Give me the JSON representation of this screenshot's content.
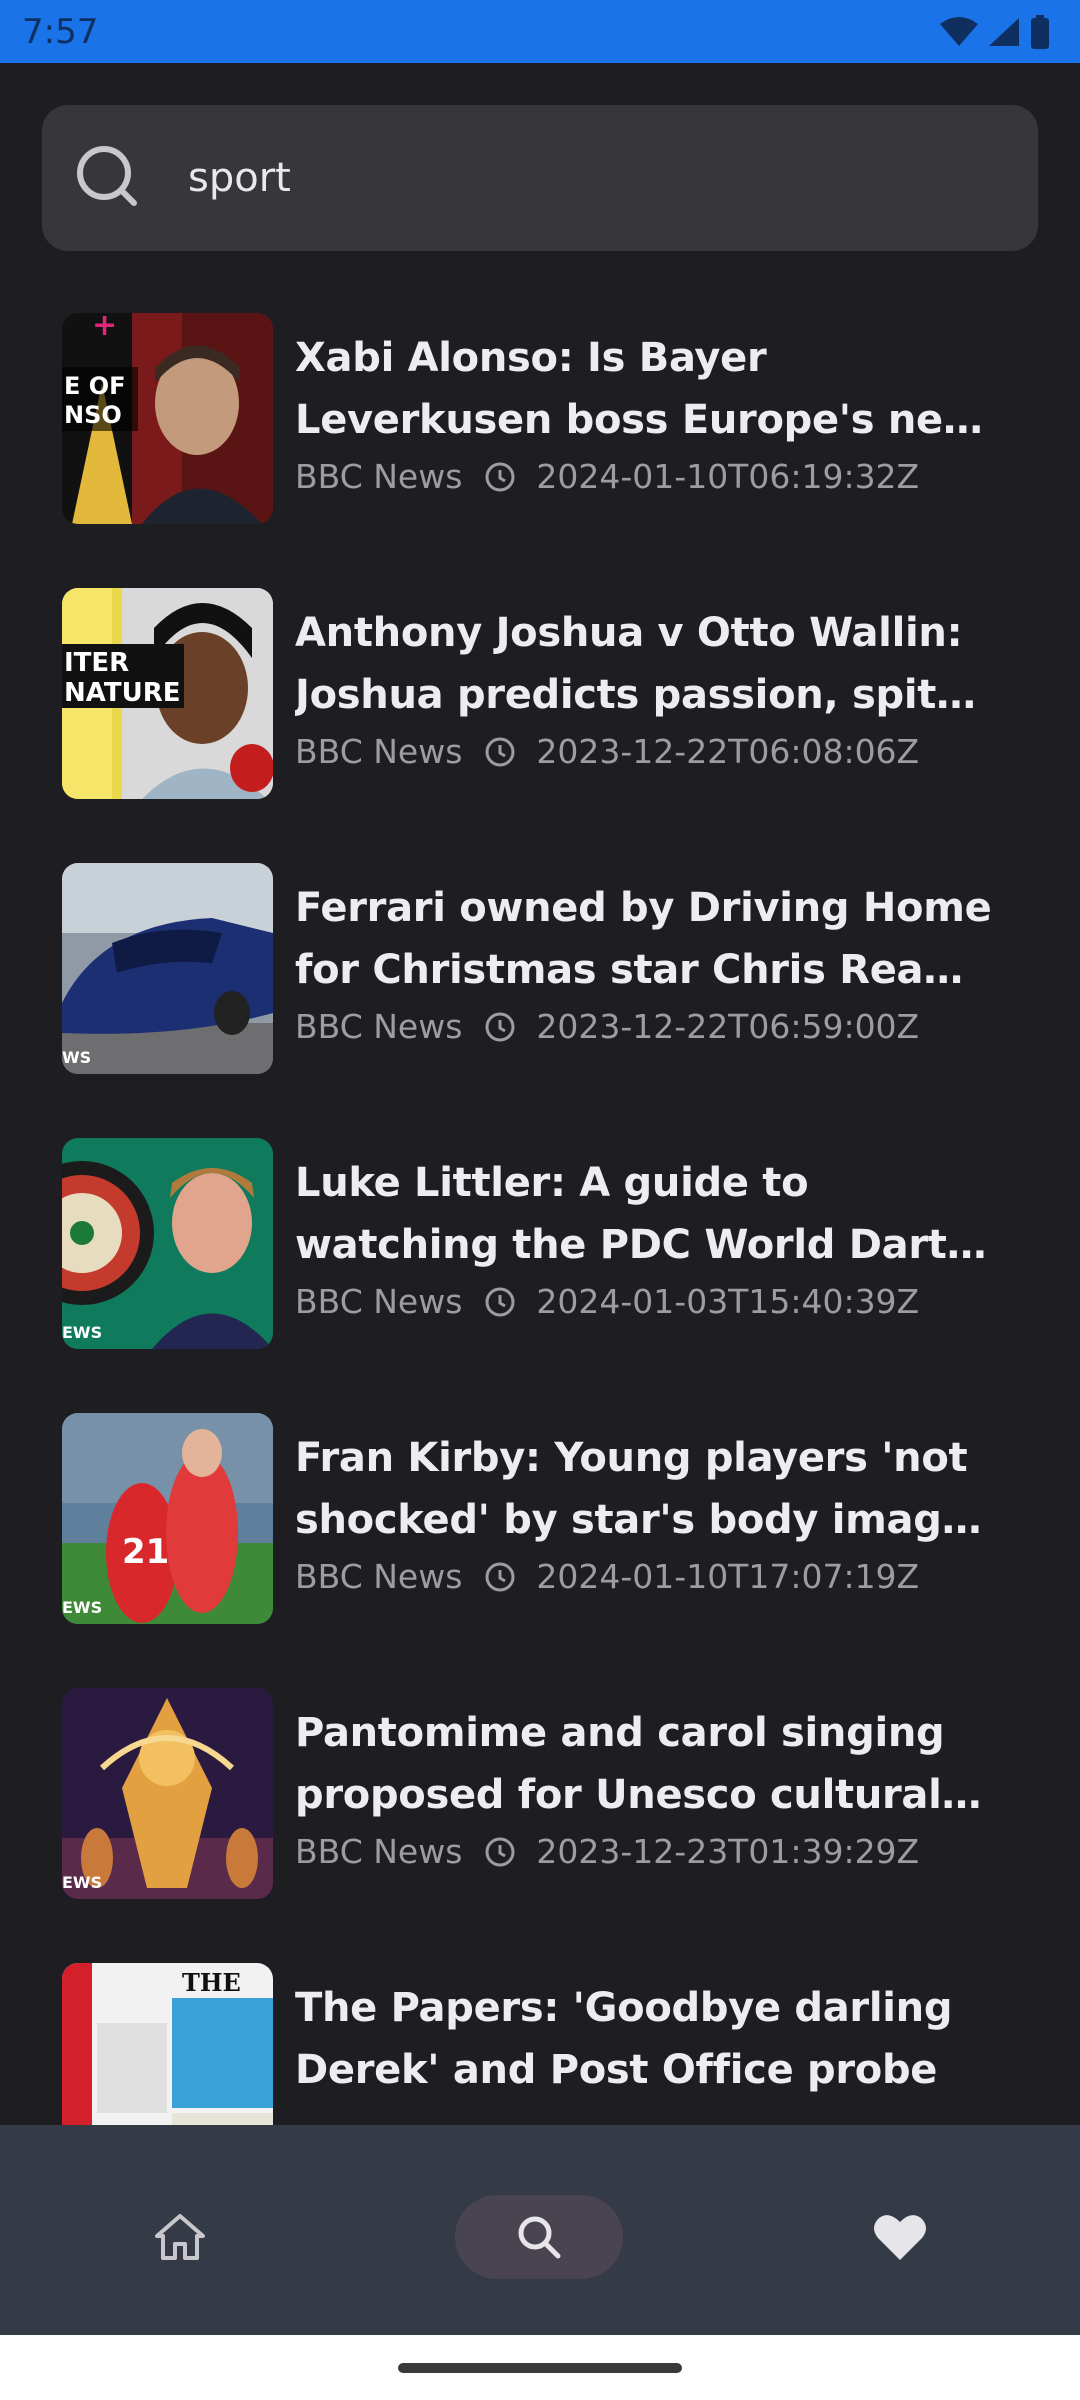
{
  "status_bar": {
    "time": "7:57",
    "icons": [
      "wifi-icon",
      "signal-icon",
      "battery-icon"
    ]
  },
  "search": {
    "query": "sport"
  },
  "articles": [
    {
      "title": "Xabi Alonso: Is Bayer Leverkusen boss Europe's next +'super coa...",
      "source": "BBC News",
      "timestamp": "2024-01-10T06:19:32Z",
      "thumb_text": "E OF NSO"
    },
    {
      "title": "Anthony Joshua v Otto Wallin: Joshua predicts passion, spite ...",
      "source": "BBC News",
      "timestamp": "2023-12-22T06:08:06Z",
      "thumb_text": "ITER NATURE"
    },
    {
      "title": "Ferrari owned by Driving Home for Christmas star Chris Rea up...",
      "source": "BBC News",
      "timestamp": "2023-12-22T06:59:00Z",
      "thumb_text": "WS"
    },
    {
      "title": "Luke Littler: A guide to watching the PDC World Darts Final",
      "source": "BBC News",
      "timestamp": "2024-01-03T15:40:39Z",
      "thumb_text": "EWS"
    },
    {
      "title": "Fran Kirby: Young players 'not shocked' by star's body image ...",
      "source": "BBC News",
      "timestamp": "2024-01-10T17:07:19Z",
      "thumb_text": "EWS"
    },
    {
      "title": "Pantomime and carol singing proposed for Unesco cultural st...",
      "source": "BBC News",
      "timestamp": "2023-12-23T01:39:29Z",
      "thumb_text": "EWS"
    },
    {
      "title": "The Papers: 'Goodbye darling Derek' and Post Office probe",
      "source": "",
      "timestamp": "",
      "thumb_text": "THE"
    }
  ],
  "bottom_nav": {
    "items": [
      "home-icon",
      "search-icon",
      "heart-icon"
    ],
    "active": "search"
  },
  "colors": {
    "status_bar": "#1a73e8",
    "background": "#1d1d22",
    "search_bg": "#37373b",
    "nav_bg": "#353a47"
  }
}
